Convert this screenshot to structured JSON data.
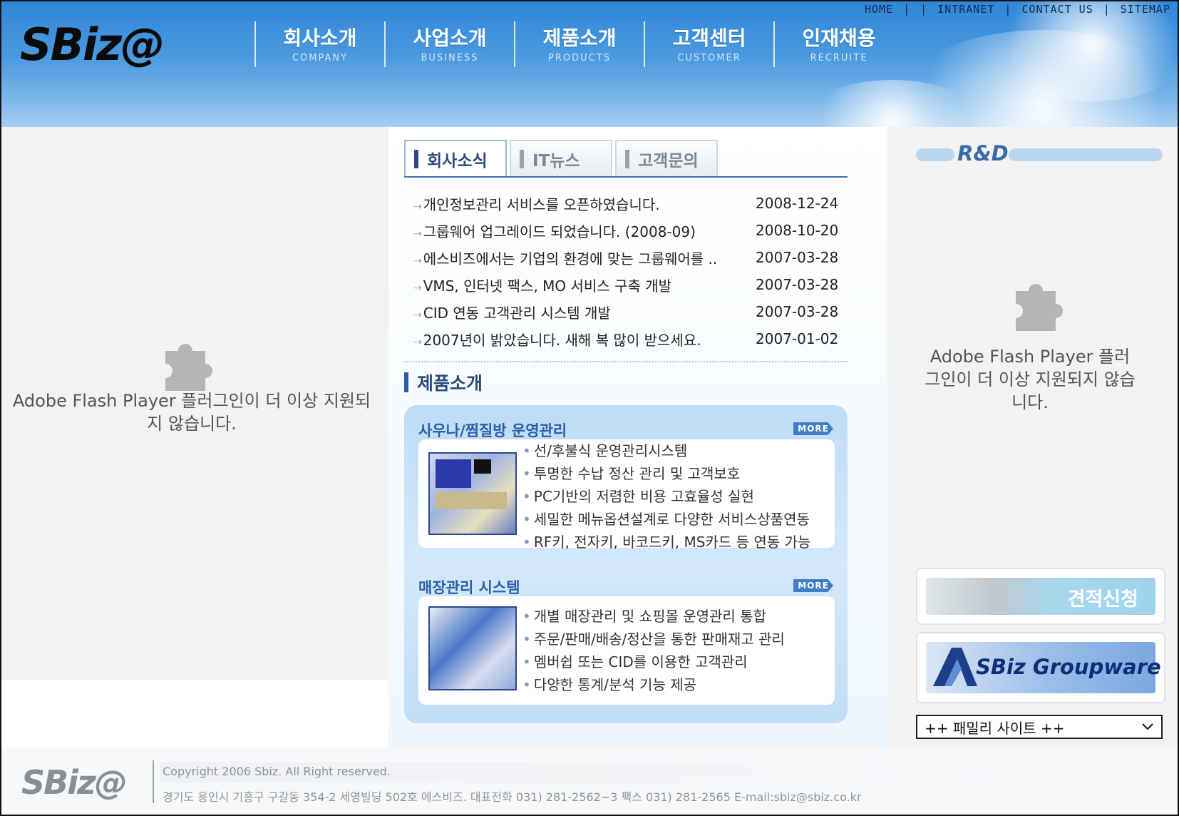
{
  "header": {
    "logo": "SBiz@",
    "top_links": [
      "HOME",
      "INTRANET",
      "CONTACT US",
      "SITEMAP"
    ],
    "nav": [
      {
        "ko": "회사소개",
        "en": "COMPANY"
      },
      {
        "ko": "사업소개",
        "en": "BUSINESS"
      },
      {
        "ko": "제품소개",
        "en": "PRODUCTS"
      },
      {
        "ko": "고객센터",
        "en": "CUSTOMER"
      },
      {
        "ko": "인재채용",
        "en": "RECRUITE"
      }
    ]
  },
  "left_flash": {
    "message": "Adobe Flash Player 플러그인이 더 이상 지원되지 않습니다.",
    "icon": "puzzle-piece-icon"
  },
  "news": {
    "tabs": [
      "회사소식",
      "IT뉴스",
      "고객문의"
    ],
    "items": [
      {
        "title": "개인정보관리 서비스를 오픈하였습니다.",
        "date": "2008-12-24"
      },
      {
        "title": "그룹웨어 업그레이드 되었습니다. (2008-09)",
        "date": "2008-10-20"
      },
      {
        "title": "에스비즈에서는 기업의 환경에 맞는 그룹웨어를 ..",
        "date": "2007-03-28"
      },
      {
        "title": "VMS, 인터넷 팩스, MO 서비스 구축 개발",
        "date": "2007-03-28"
      },
      {
        "title": "CID 연동 고객관리 시스템 개발",
        "date": "2007-03-28"
      },
      {
        "title": "2007년이 밝았습니다. 새해 복 많이 받으세요.",
        "date": "2007-01-02"
      }
    ]
  },
  "products": {
    "section_title": "제품소개",
    "more_label": "MORE",
    "items": [
      {
        "title": "사우나/찜질방 운영관리",
        "features": [
          "선/후불식 운영관리시스템",
          "투명한 수납 정산 관리 및 고객보호",
          "PC기반의 저렴한 비용 고효율성 실현",
          "세밀한 메뉴옵션설계로 다양한 서비스상품연동",
          "RF키, 전자키, 바코드키, MS카드 등 연동 가능"
        ]
      },
      {
        "title": "매장관리 시스템",
        "features": [
          "개별 매장관리 및 쇼핑몰 운영관리 통합",
          "주문/판매/배송/정산을 통한 판매재고 관리",
          "멤버쉽 또는 CID를 이용한 고객관리",
          "다양한 통계/분석 기능 제공"
        ]
      }
    ]
  },
  "right": {
    "rd_label": "R&D",
    "flash_message": "Adobe Flash Player 플러그인이 더 이상 지원되지 않습니다.",
    "banner_estimate": "견적신청",
    "banner_groupware": "SBiz Groupware",
    "family_select": "++ 패밀리 사이트 ++"
  },
  "footer": {
    "logo": "SBiz@",
    "copyright": "Copyright 2006 Sbiz. All Right reserved.",
    "address": "경기도 용인시 기흥구 구갈동 354-2 세영빌딩 502호 에스비즈.   대표전화 031) 281-2562~3   팩스 031) 281-2565   E-mail:sbiz@sbiz.co.kr"
  },
  "colors": {
    "header_sky": "#4b9ae0",
    "accent_blue": "#2a4a8c",
    "product_title": "#2b5fa8"
  }
}
